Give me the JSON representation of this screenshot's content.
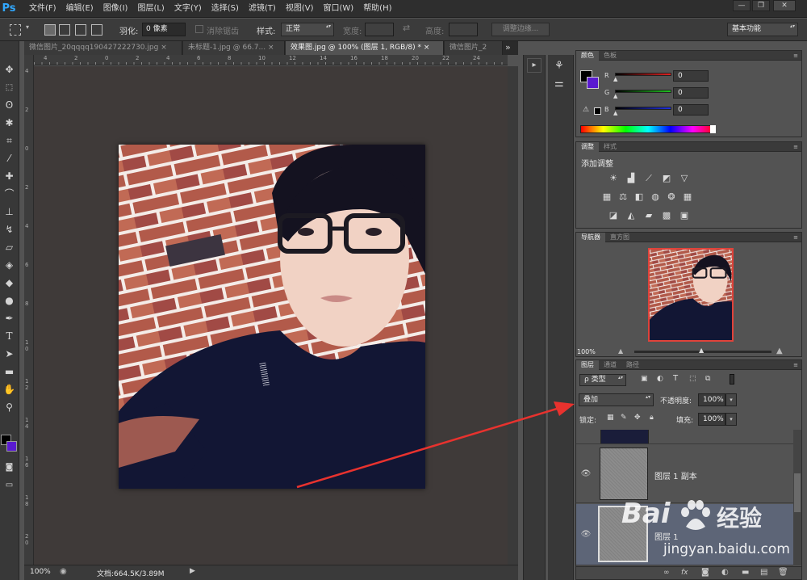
{
  "app": {
    "logo": "Ps"
  },
  "menu": [
    "文件(F)",
    "编辑(E)",
    "图像(I)",
    "图层(L)",
    "文字(Y)",
    "选择(S)",
    "滤镜(T)",
    "视图(V)",
    "窗口(W)",
    "帮助(H)"
  ],
  "window_controls": {
    "minimize": "—",
    "restore": "❐",
    "close": "✕"
  },
  "options": {
    "feather_label": "羽化:",
    "feather_value": "0 像素",
    "antialias_label": "消除锯齿",
    "style_label": "样式:",
    "style_value": "正常",
    "width_label": "宽度:",
    "height_label": "高度:",
    "refine_edge": "调整边缘...",
    "workspace": "基本功能"
  },
  "tabs": [
    {
      "label": "微信图片_20qqqq190427222730.jpg",
      "close": "×"
    },
    {
      "label": "未标题-1.jpg @ 66.7...",
      "close": "×"
    },
    {
      "label": "效果图.jpg @ 100% (图层 1, RGB/8) *",
      "close": "×",
      "active": true
    },
    {
      "label": "微信图片_2",
      "close": ""
    }
  ],
  "tabs_overflow": "»",
  "ruler_top": [
    "4",
    "2",
    "0",
    "2",
    "4",
    "6",
    "8",
    "10",
    "12",
    "14",
    "16",
    "18",
    "20",
    "22",
    "24"
  ],
  "ruler_left": [
    "4",
    "2",
    "0",
    "2",
    "4",
    "6",
    "8",
    "1 0",
    "1 2",
    "1 4",
    "1 6",
    "1 8",
    "2 0"
  ],
  "status": {
    "zoom": "100%",
    "doc": "文档:664.5K/3.89M"
  },
  "color_panel": {
    "tabs": [
      "颜色",
      "色板"
    ],
    "channels": [
      {
        "label": "R",
        "value": "0",
        "color": "#e02020"
      },
      {
        "label": "G",
        "value": "0",
        "color": "#20c020"
      },
      {
        "label": "B",
        "value": "0",
        "color": "#2030e0"
      }
    ]
  },
  "adjust_panel": {
    "tabs": [
      "调整",
      "样式"
    ],
    "title": "添加调整"
  },
  "navigator": {
    "tabs": [
      "导航器",
      "直方图"
    ],
    "zoom": "100%"
  },
  "layers": {
    "tabs": [
      "图层",
      "通道",
      "路径"
    ],
    "filter_label": "ρ 类型",
    "blend_mode": "叠加",
    "opacity_label": "不透明度:",
    "opacity_value": "100%",
    "lock_label": "锁定:",
    "fill_label": "填充:",
    "fill_value": "100%",
    "items": [
      {
        "name": "图层 1 副本"
      },
      {
        "name": "图层 1"
      }
    ]
  },
  "watermark": {
    "brand": "Bai",
    "brand2": "经验",
    "url": "jingyan.baidu.com"
  },
  "colors": {
    "accent_arrow": "#e8322e",
    "ps_blue": "#31a8ff",
    "foreground": "#000000",
    "background": "#5a1ad0"
  }
}
